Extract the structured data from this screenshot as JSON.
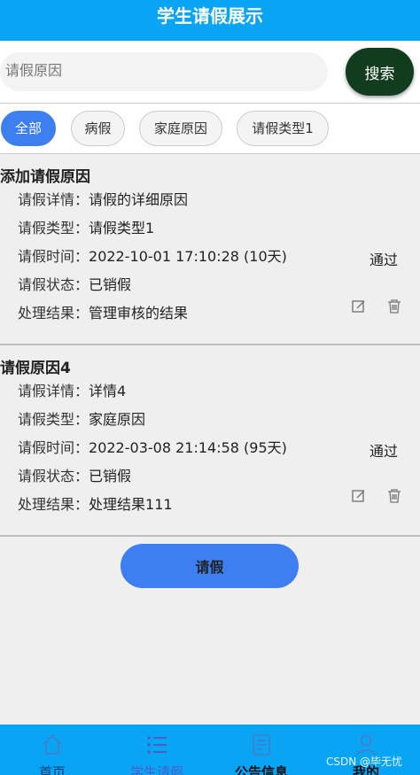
{
  "header": {
    "title": "学生请假展示"
  },
  "search": {
    "placeholder": "请假原因",
    "button_label": "搜索"
  },
  "filters": [
    {
      "label": "全部",
      "active": true
    },
    {
      "label": "病假",
      "active": false
    },
    {
      "label": "家庭原因",
      "active": false
    },
    {
      "label": "请假类型1",
      "active": false
    }
  ],
  "records": [
    {
      "title": "添加请假原因",
      "detail_label": "请假详情：",
      "detail": "请假的详细原因",
      "type_label": "请假类型：",
      "type": "请假类型1",
      "time_label": "请假时间：",
      "time": "2022-10-01 17:10:28 (10天)",
      "state_label": "请假状态：",
      "state": "已销假",
      "result_label": "处理结果：",
      "result": "管理审核的结果",
      "approval": "通过"
    },
    {
      "title": "请假原因4",
      "detail_label": "请假详情：",
      "detail": "详情4",
      "type_label": "请假类型：",
      "type": "家庭原因",
      "time_label": "请假时间：",
      "time": "2022-03-08 21:14:58 (95天)",
      "state_label": "请假状态：",
      "state": "已销假",
      "result_label": "处理结果：",
      "result": "处理结果111",
      "approval": "通过"
    }
  ],
  "leave_button": "请假",
  "tabbar": [
    {
      "label": "首页",
      "icon": "home-icon",
      "active": false
    },
    {
      "label": "学生请假",
      "icon": "list-icon",
      "active": true
    },
    {
      "label": "公告信息",
      "icon": "document-icon",
      "active": false
    },
    {
      "label": "我的",
      "icon": "user-icon",
      "active": false
    }
  ],
  "watermark": "CSDN @毕无忧"
}
